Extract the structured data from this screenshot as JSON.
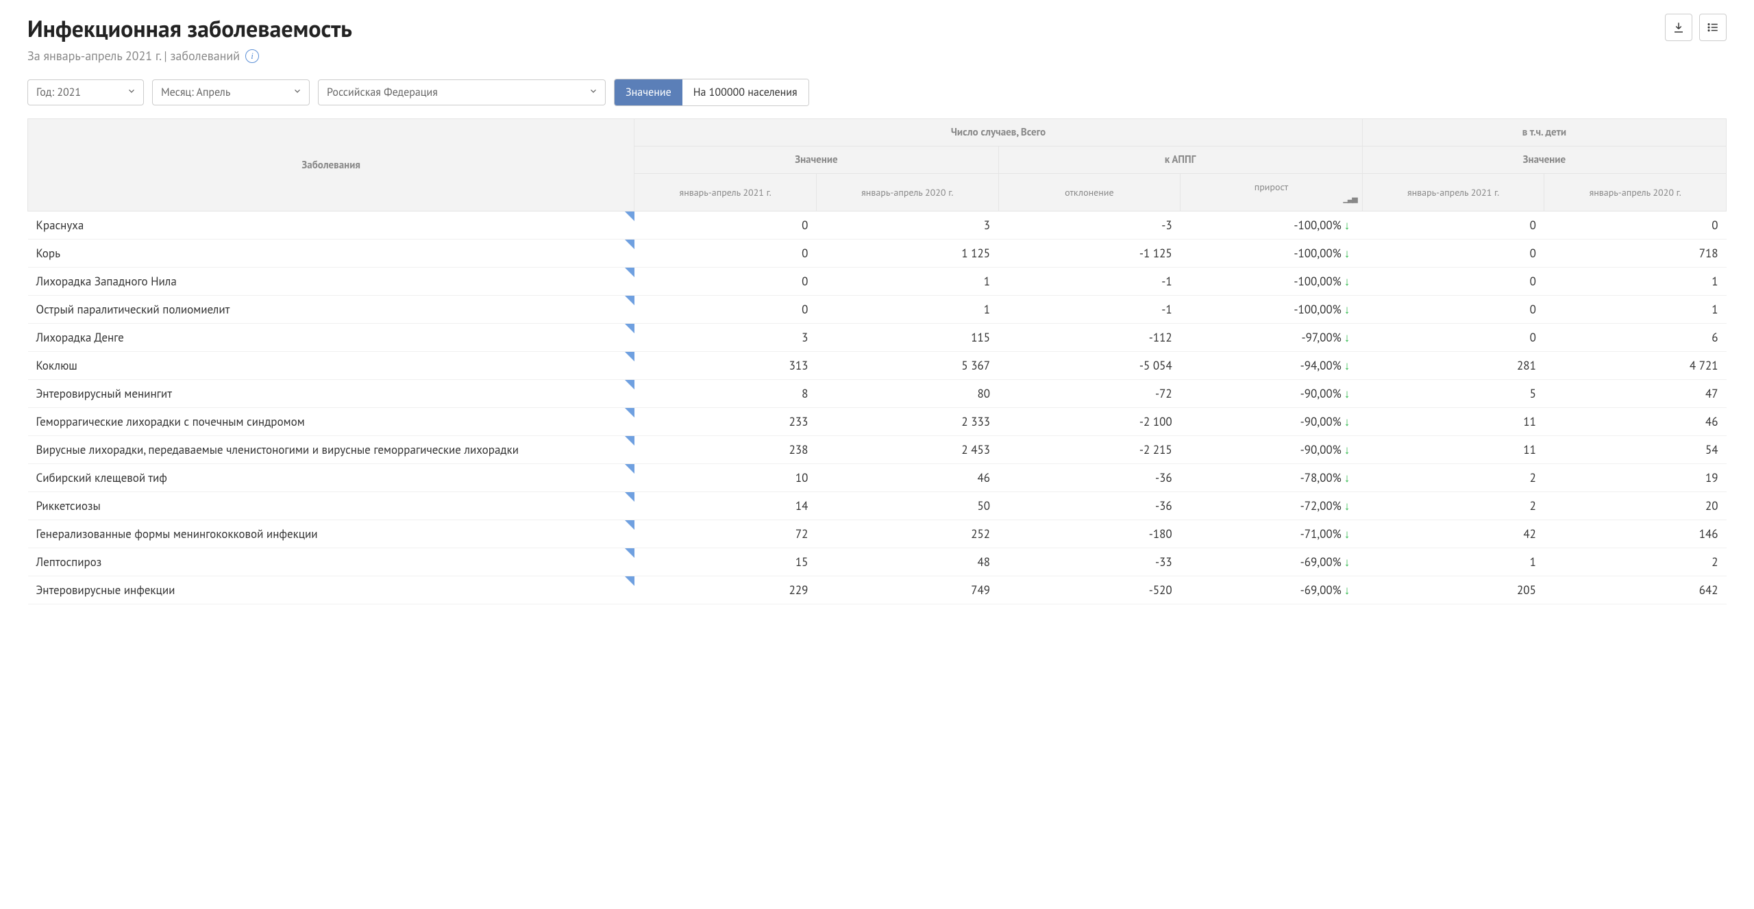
{
  "header": {
    "title": "Инфекционная заболеваемость",
    "subtitle": "За январь-апрель 2021 г. | заболеваний"
  },
  "filters": {
    "year": "Год: 2021",
    "month": "Месяц: Апрель",
    "region": "Российская  Федерация",
    "toggle_value": "Значение",
    "toggle_per100k": "На 100000 населения"
  },
  "columns": {
    "disease": "Заболевания",
    "total": "Число случаев, Всего",
    "children": "в т.ч. дети",
    "value": "Значение",
    "appg": "к АППГ",
    "jan_apr_2021": "январь-апрель 2021 г.",
    "jan_apr_2020": "январь-апрель 2020 г.",
    "deviation": "отклонение",
    "growth": "прирост"
  },
  "rows": [
    {
      "disease": "Краснуха",
      "v21": "0",
      "v20": "3",
      "dev": "-3",
      "grow": "-100,00%",
      "c21": "0",
      "c20": "0"
    },
    {
      "disease": "Корь",
      "v21": "0",
      "v20": "1 125",
      "dev": "-1 125",
      "grow": "-100,00%",
      "c21": "0",
      "c20": "718"
    },
    {
      "disease": "Лихорадка Западного Нила",
      "v21": "0",
      "v20": "1",
      "dev": "-1",
      "grow": "-100,00%",
      "c21": "0",
      "c20": "1"
    },
    {
      "disease": "Острый паралитический полиомиелит",
      "v21": "0",
      "v20": "1",
      "dev": "-1",
      "grow": "-100,00%",
      "c21": "0",
      "c20": "1"
    },
    {
      "disease": "Лихорадка Денге",
      "v21": "3",
      "v20": "115",
      "dev": "-112",
      "grow": "-97,00%",
      "c21": "0",
      "c20": "6"
    },
    {
      "disease": "Коклюш",
      "v21": "313",
      "v20": "5 367",
      "dev": "-5 054",
      "grow": "-94,00%",
      "c21": "281",
      "c20": "4 721"
    },
    {
      "disease": "Энтеровирусный менингит",
      "v21": "8",
      "v20": "80",
      "dev": "-72",
      "grow": "-90,00%",
      "c21": "5",
      "c20": "47"
    },
    {
      "disease": "Геморрагические лихорадки с почечным синдромом",
      "v21": "233",
      "v20": "2 333",
      "dev": "-2 100",
      "grow": "-90,00%",
      "c21": "11",
      "c20": "46"
    },
    {
      "disease": "Вирусные лихорадки, передаваемые членистоногими и вирусные геморрагические лихорадки",
      "v21": "238",
      "v20": "2 453",
      "dev": "-2 215",
      "grow": "-90,00%",
      "c21": "11",
      "c20": "54"
    },
    {
      "disease": "Сибирский клещевой тиф",
      "v21": "10",
      "v20": "46",
      "dev": "-36",
      "grow": "-78,00%",
      "c21": "2",
      "c20": "19"
    },
    {
      "disease": "Риккетсиозы",
      "v21": "14",
      "v20": "50",
      "dev": "-36",
      "grow": "-72,00%",
      "c21": "2",
      "c20": "20"
    },
    {
      "disease": "Генерализованные формы менингококковой инфекции",
      "v21": "72",
      "v20": "252",
      "dev": "-180",
      "grow": "-71,00%",
      "c21": "42",
      "c20": "146"
    },
    {
      "disease": "Лептоспироз",
      "v21": "15",
      "v20": "48",
      "dev": "-33",
      "grow": "-69,00%",
      "c21": "1",
      "c20": "2"
    },
    {
      "disease": "Энтеровирусные инфекции",
      "v21": "229",
      "v20": "749",
      "dev": "-520",
      "grow": "-69,00%",
      "c21": "205",
      "c20": "642"
    }
  ]
}
